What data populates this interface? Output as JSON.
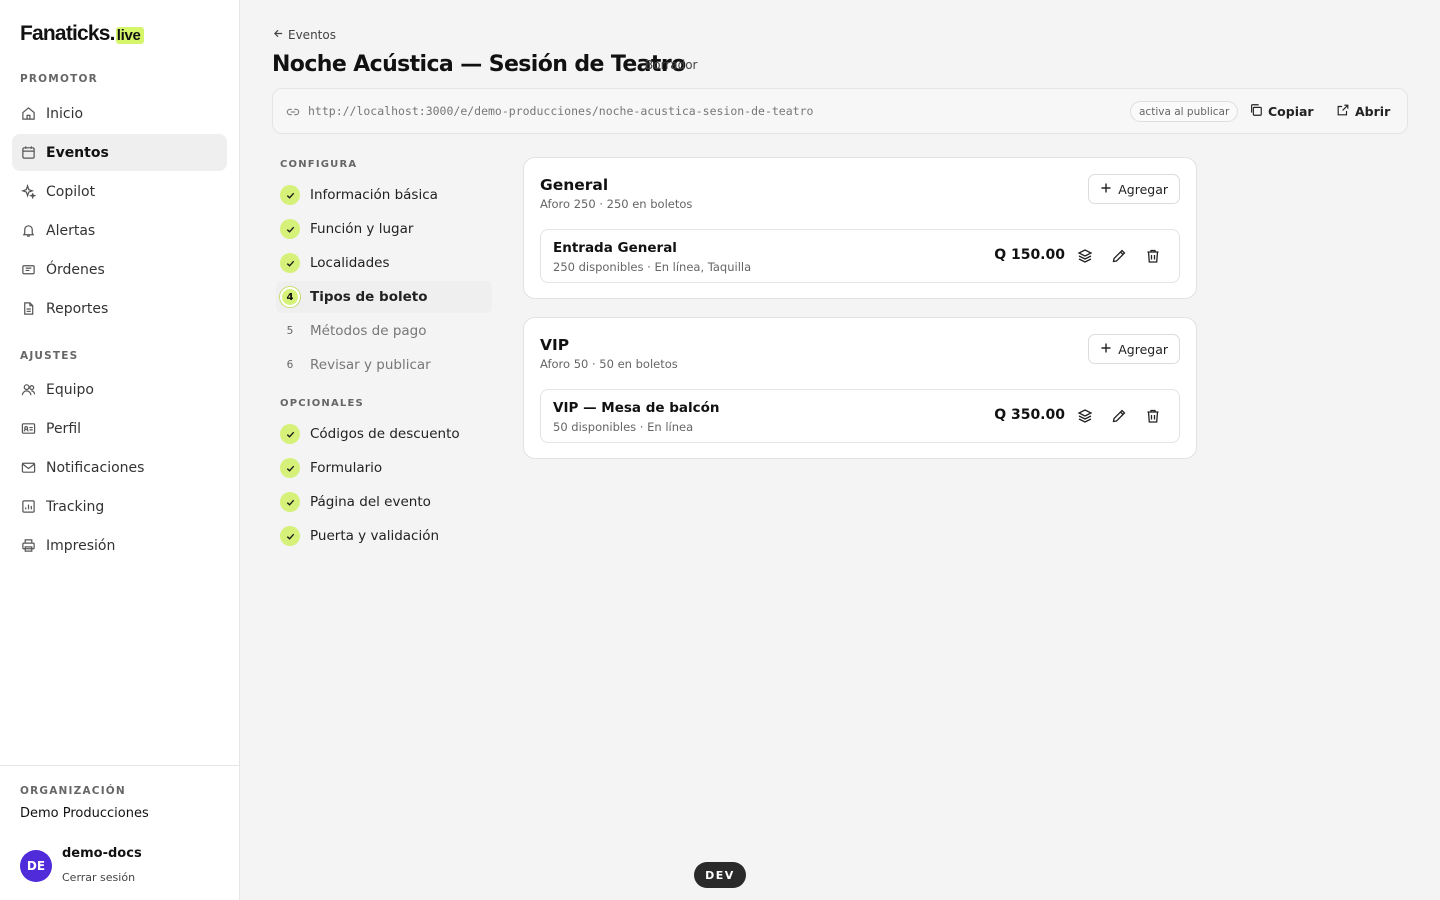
{
  "brand": {
    "name": "Fanaticks.",
    "suffix": "live",
    "accent": "#d5f56a"
  },
  "sidebar": {
    "section_promotor": "PROMOTOR",
    "promotor_items": [
      {
        "label": "Inicio",
        "icon": "home-icon"
      },
      {
        "label": "Eventos",
        "icon": "calendar-icon",
        "active": true
      },
      {
        "label": "Copilot",
        "icon": "sparkles-icon"
      },
      {
        "label": "Alertas",
        "icon": "bell-icon"
      },
      {
        "label": "Órdenes",
        "icon": "ticket-icon"
      },
      {
        "label": "Reportes",
        "icon": "file-icon"
      }
    ],
    "section_ajustes": "AJUSTES",
    "ajustes_items": [
      {
        "label": "Equipo",
        "icon": "users-icon"
      },
      {
        "label": "Perfil",
        "icon": "id-card-icon"
      },
      {
        "label": "Notificaciones",
        "icon": "mail-icon"
      },
      {
        "label": "Tracking",
        "icon": "chart-icon"
      },
      {
        "label": "Impresión",
        "icon": "printer-icon"
      }
    ],
    "org_label": "ORGANIZACIÓN",
    "org_name": "Demo Producciones",
    "user": {
      "initials": "DE",
      "name": "demo-docs",
      "logout": "Cerrar sesión",
      "avatar_color": "#4f2bd9"
    }
  },
  "header": {
    "back_label": "Eventos",
    "title": "Noche Acústica — Sesión de Teatro",
    "status": "Borrador"
  },
  "url_bar": {
    "url": "http://localhost:3000/e/demo-producciones/noche-acustica-sesion-de-teatro",
    "pill": "activa al publicar",
    "copy_label": "Copiar",
    "open_label": "Abrir"
  },
  "steps": {
    "configura_label": "CONFIGURA",
    "configura": [
      {
        "label": "Información básica",
        "state": "done"
      },
      {
        "label": "Función y lugar",
        "state": "done"
      },
      {
        "label": "Localidades",
        "state": "done"
      },
      {
        "label": "Tipos de boleto",
        "state": "current",
        "num": "4"
      },
      {
        "label": "Métodos de pago",
        "state": "pending",
        "num": "5"
      },
      {
        "label": "Revisar y publicar",
        "state": "pending",
        "num": "6"
      }
    ],
    "opcionales_label": "OPCIONALES",
    "opcionales": [
      {
        "label": "Códigos de descuento",
        "state": "done"
      },
      {
        "label": "Formulario",
        "state": "done"
      },
      {
        "label": "Página del evento",
        "state": "done"
      },
      {
        "label": "Puerta y validación",
        "state": "done"
      }
    ]
  },
  "sections": [
    {
      "title": "General",
      "subtitle": "Aforo 250 · 250 en boletos",
      "add_label": "Agregar",
      "tickets": [
        {
          "name": "Entrada General",
          "meta": "250 disponibles · En línea, Taquilla",
          "price": "Q 150.00"
        }
      ]
    },
    {
      "title": "VIP",
      "subtitle": "Aforo 50 · 50 en boletos",
      "add_label": "Agregar",
      "tickets": [
        {
          "name": "VIP — Mesa de balcón",
          "meta": "50 disponibles · En línea",
          "price": "Q 350.00"
        }
      ]
    }
  ],
  "dev_badge": "DEV"
}
